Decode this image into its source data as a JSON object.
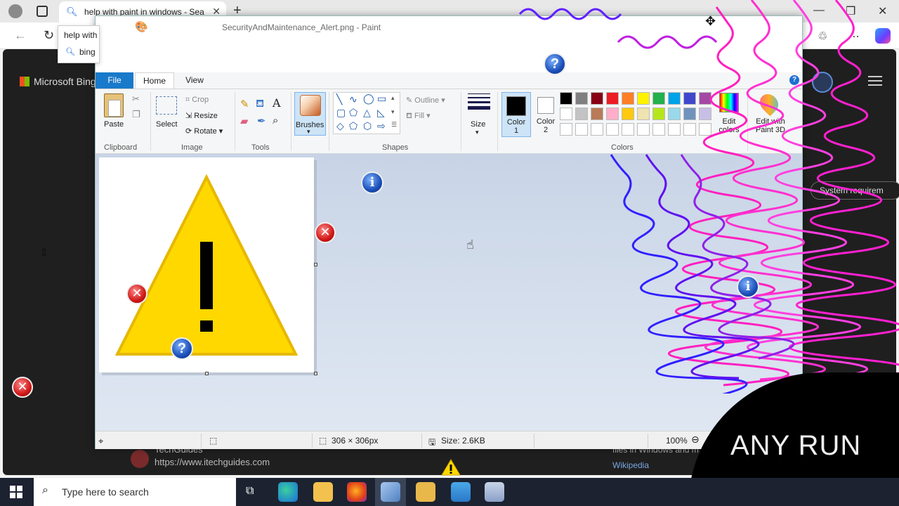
{
  "browser": {
    "tab_title": "help with paint in windows - Sea",
    "address_text": "help with",
    "suggestion_text": "bing",
    "bing_logo": "Microsoft Bing",
    "result_source": "TechGuides",
    "result_url": "https://www.itechguides.com",
    "side_pill": "System requirem",
    "side_text": "files in Windows and m... in",
    "side_link": "Wikipedia"
  },
  "paint": {
    "window_title": "SecurityAndMaintenance_Alert.png - Paint",
    "tabs": {
      "file": "File",
      "home": "Home",
      "view": "View"
    },
    "clipboard": {
      "paste": "Paste",
      "label": "Clipboard"
    },
    "image": {
      "select": "Select",
      "crop": "Crop",
      "resize": "Resize",
      "rotate": "Rotate",
      "label": "Image"
    },
    "tools": {
      "label": "Tools"
    },
    "brushes": {
      "label": "Brushes"
    },
    "shapes": {
      "outline": "Outline",
      "fill": "Fill",
      "label": "Shapes"
    },
    "size": {
      "label": "Size"
    },
    "colors": {
      "color1": "Color\n1",
      "color2": "Color\n2",
      "edit_colors": "Edit\ncolors",
      "paint3d": "Edit with\nPaint 3D",
      "label": "Colors",
      "palette_row1": [
        "#000000",
        "#7f7f7f",
        "#880015",
        "#ed1c24",
        "#ff7f27",
        "#fff200",
        "#22b14c",
        "#00a2e8",
        "#3f48cc",
        "#a349a4"
      ],
      "palette_row2": [
        "#ffffff",
        "#c3c3c3",
        "#b97a57",
        "#ffaec9",
        "#ffc90e",
        "#efe4b0",
        "#b5e61d",
        "#99d9ea",
        "#7092be",
        "#c8bfe7"
      ],
      "palette_row3": [
        "#ffffff",
        "#ffffff",
        "#ffffff",
        "#ffffff",
        "#ffffff",
        "#ffffff",
        "#ffffff",
        "#ffffff",
        "#ffffff",
        "#ffffff"
      ],
      "color1_value": "#000000",
      "color2_value": "#ffffff"
    },
    "status": {
      "dimensions": "306 × 306px",
      "file_size": "Size: 2.6KB",
      "zoom": "100%"
    },
    "image_content": {
      "symbol": "!"
    }
  },
  "overlay": {
    "watermark": "ANY RUN"
  },
  "taskbar": {
    "search_placeholder": "Type here to search"
  }
}
